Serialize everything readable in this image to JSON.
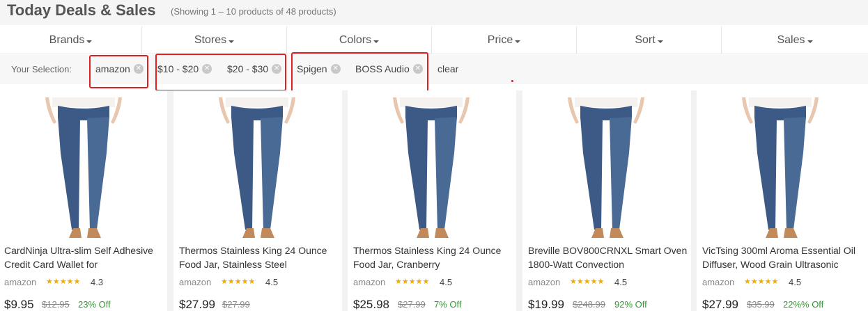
{
  "header": {
    "title": "Today Deals & Sales",
    "subtitle": "(Showing 1 – 10 products of 48 products)"
  },
  "filters": [
    "Brands",
    "Stores",
    "Colors",
    "Price",
    "Sort",
    "Sales"
  ],
  "selection": {
    "label": "Your Selection:",
    "chips": [
      "amazon",
      "$10 - $20",
      "$20 - $30",
      "Spigen",
      "BOSS Audio"
    ],
    "clear_label": "clear"
  },
  "colors": {
    "highlight": "#e02020",
    "star": "#f0a800",
    "discount": "#2e9a2e",
    "denim": "#3d5a86"
  },
  "products": [
    {
      "name": "CardNinja Ultra-slim Self Adhesive Credit Card Wallet for",
      "store": "amazon",
      "stars": "★★★★★",
      "rating": "4.3",
      "price": "$9.95",
      "old_price": "$12.95",
      "discount": "23% Off"
    },
    {
      "name": "Thermos Stainless King 24 Ounce Food Jar, Stainless Steel",
      "store": "amazon",
      "stars": "★★★★★",
      "rating": "4.5",
      "price": "$27.99",
      "old_price": "$27.99",
      "discount": ""
    },
    {
      "name": "Thermos Stainless King 24 Ounce Food Jar, Cranberry",
      "store": "amazon",
      "stars": "★★★★★",
      "rating": "4.5",
      "price": "$25.98",
      "old_price": "$27.99",
      "discount": "7% Off"
    },
    {
      "name": "Breville BOV800CRNXL Smart Oven 1800-Watt Convection",
      "store": "amazon",
      "stars": "★★★★★",
      "rating": "4.5",
      "price": "$19.99",
      "old_price": "$248.99",
      "discount": "92% Off"
    },
    {
      "name": "VicTsing 300ml Aroma Essential Oil Diffuser, Wood Grain Ultrasonic",
      "store": "amazon",
      "stars": "★★★★★",
      "rating": "4.5",
      "price": "$27.99",
      "old_price": "$35.99",
      "discount": "22%% Off"
    }
  ]
}
